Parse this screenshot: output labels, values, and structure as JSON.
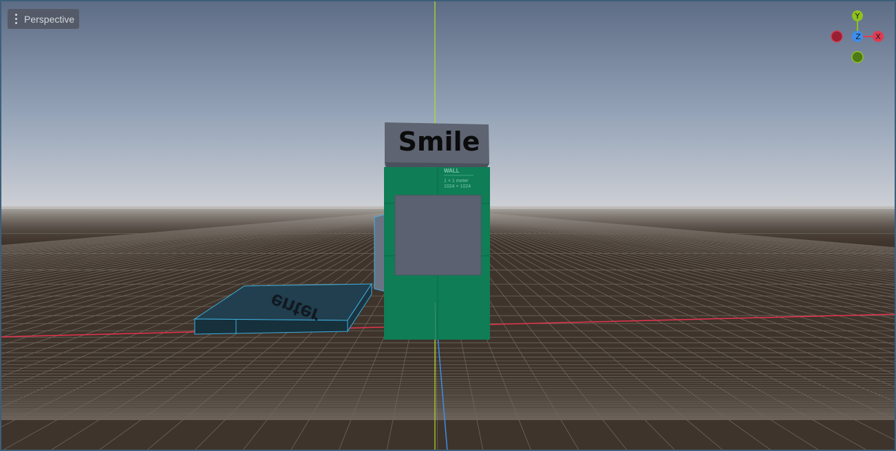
{
  "view_menu": {
    "label": "Perspective",
    "icon": "kebab-menu-icon"
  },
  "scene_objects": {
    "sign_text": "Smile",
    "platform_text": "enter",
    "wall_texture": {
      "title": "WALL",
      "line1": "1 × 1 meter",
      "line2": "1024 × 1024"
    }
  },
  "gizmo": {
    "y_label": "Y",
    "x_label": "X",
    "z_label": "Z"
  },
  "colors": {
    "sky_top": "#5b6b84",
    "sky_horizon": "#c9ccd2",
    "ground": "#3e342b",
    "grid_line": "#6f665e",
    "x_axis": "#e8334f",
    "y_axis": "#8fc12a",
    "z_axis": "#3b8ff0",
    "wall_green": "#0f7d55",
    "sign_gray": "#5e6471",
    "platform_teal": "#1e3a48",
    "selection_frame": "#3d5f7a"
  }
}
